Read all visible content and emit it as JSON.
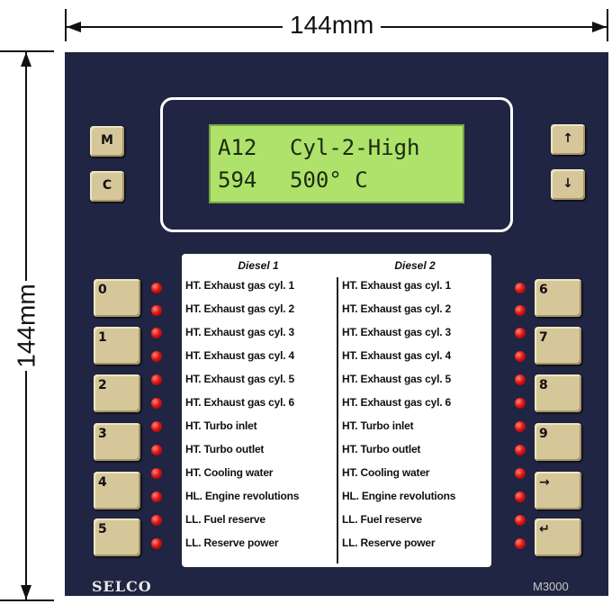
{
  "dimensions": {
    "width_label": "144mm",
    "height_label": "144mm"
  },
  "display": {
    "line1_code": "A12",
    "line1_text": "Cyl-2-High",
    "line2_value": "594",
    "line2_text": "500° C"
  },
  "buttons": {
    "m": "M",
    "c": "C",
    "up": "↑",
    "down": "↓",
    "left_numbers": [
      "0",
      "1",
      "2",
      "3",
      "4",
      "5"
    ],
    "right_numbers": [
      "6",
      "7",
      "8",
      "9"
    ],
    "arrow_right": "→",
    "enter": "↵"
  },
  "table": {
    "diesel1_title": "Diesel 1",
    "diesel2_title": "Diesel 2",
    "diesel1_items": [
      "HT. Exhaust gas cyl. 1",
      "HT. Exhaust gas cyl. 2",
      "HT. Exhaust gas cyl. 3",
      "HT. Exhaust gas cyl. 4",
      "HT. Exhaust gas cyl. 5",
      "HT. Exhaust gas cyl. 6",
      "HT. Turbo inlet",
      "HT. Turbo outlet",
      "HT. Cooling water",
      "HL. Engine revolutions",
      "LL. Fuel reserve",
      "LL. Reserve power"
    ],
    "diesel2_items": [
      "HT. Exhaust gas cyl. 1",
      "HT. Exhaust gas cyl. 2",
      "HT. Exhaust gas cyl. 3",
      "HT. Exhaust gas cyl. 4",
      "HT. Exhaust gas cyl. 5",
      "HT. Exhaust gas cyl. 6",
      "HT. Turbo inlet",
      "HT. Turbo outlet",
      "HT. Cooling water",
      "HL. Engine revolutions",
      "LL. Fuel reserve",
      "LL. Reserve power"
    ]
  },
  "brand": "SELCO",
  "model": "M3000",
  "colors": {
    "panel": "#1f2542",
    "lcd": "#aee26a",
    "button": "#d6c79a",
    "led": "#e01616"
  }
}
